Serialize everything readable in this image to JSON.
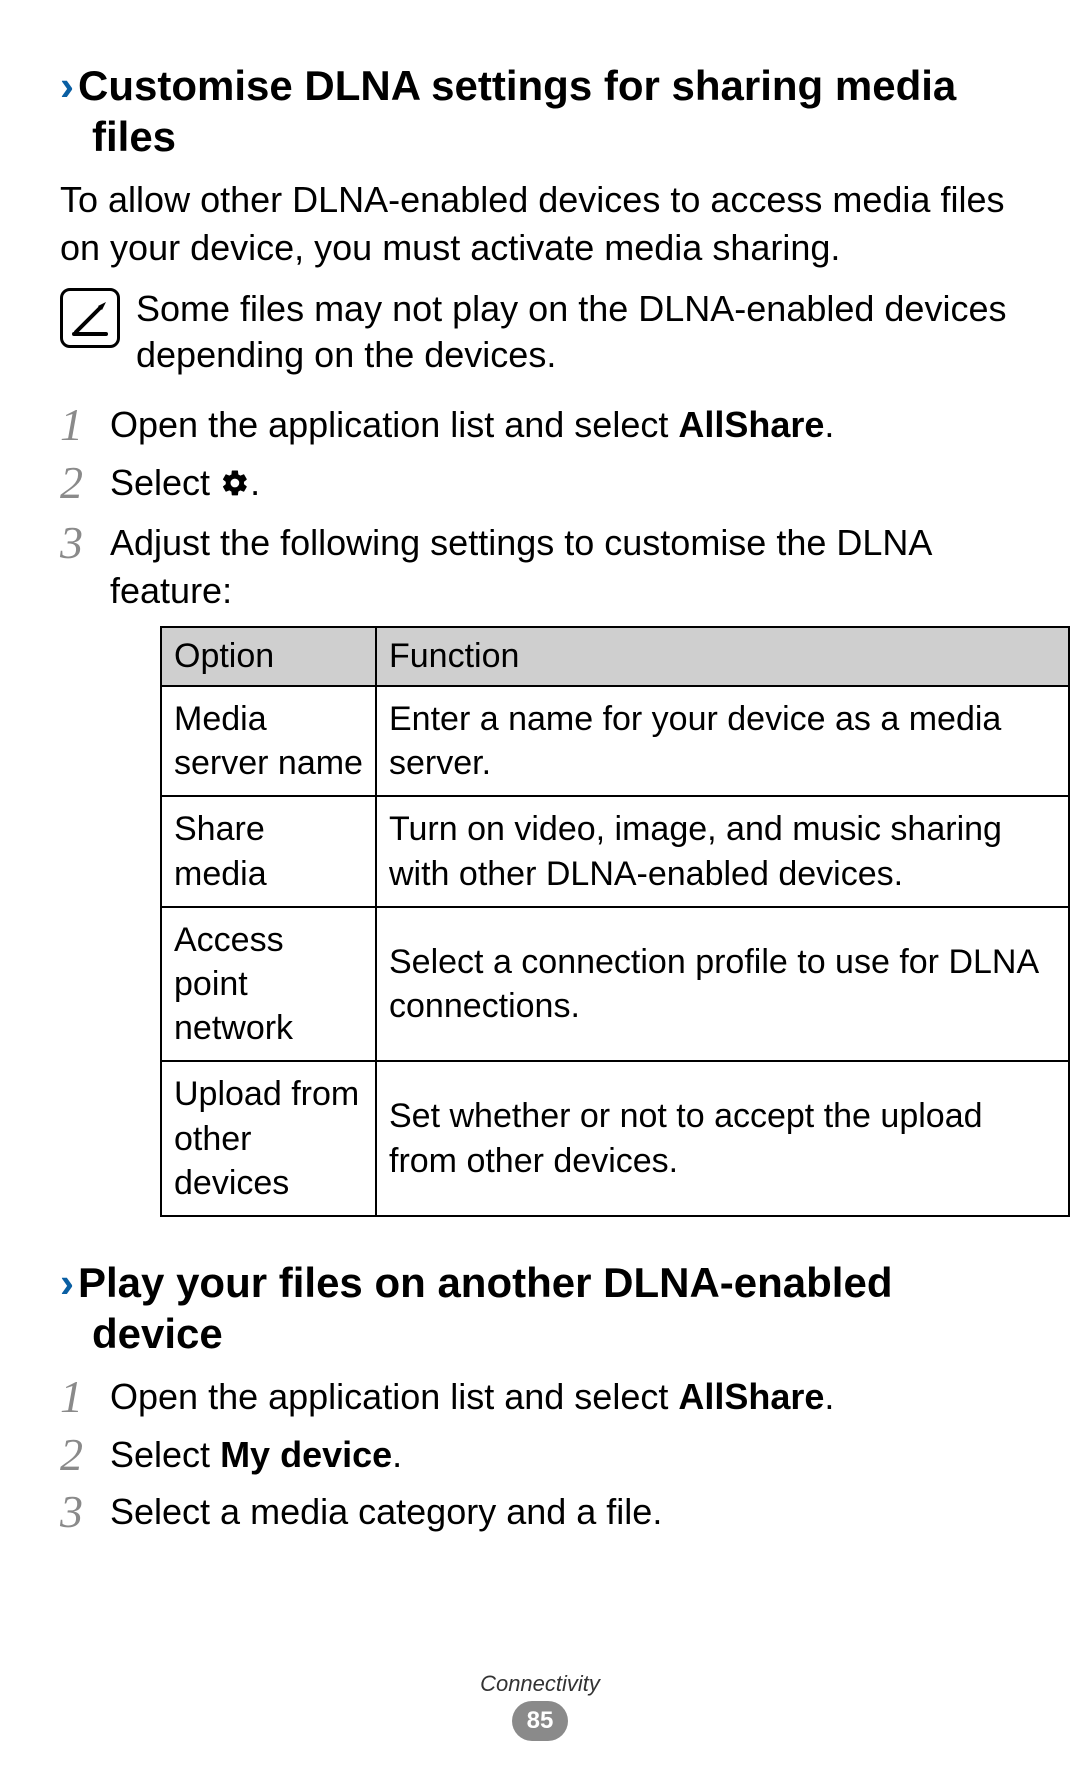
{
  "section1": {
    "heading_line1": "Customise DLNA settings for sharing media",
    "heading_line2": "files",
    "intro": "To allow other DLNA-enabled devices to access media files on your device, you must activate media sharing.",
    "note": "Some files may not play on the DLNA-enabled devices depending on the devices.",
    "steps": {
      "s1_pre": "Open the application list and select ",
      "s1_bold": "AllShare",
      "s1_post": ".",
      "s2_pre": "Select ",
      "s2_post": ".",
      "s3": "Adjust the following settings to customise the DLNA feature:"
    },
    "table": {
      "head_option": "Option",
      "head_function": "Function",
      "rows": [
        {
          "option": "Media server name",
          "function": "Enter a name for your device as a media server."
        },
        {
          "option": "Share media",
          "function": "Turn on video, image, and music sharing with other DLNA-enabled devices."
        },
        {
          "option": "Access point network",
          "function": "Select a connection profile to use for DLNA connections."
        },
        {
          "option": "Upload from other devices",
          "function": "Set whether or not to accept the upload from other devices."
        }
      ]
    }
  },
  "section2": {
    "heading_line1": "Play your files on another DLNA-enabled",
    "heading_line2": "device",
    "steps": {
      "s1_pre": "Open the application list and select ",
      "s1_bold": "AllShare",
      "s1_post": ".",
      "s2_pre": "Select ",
      "s2_bold": "My device",
      "s2_post": ".",
      "s3": "Select a media category and a file."
    }
  },
  "footer": {
    "category": "Connectivity",
    "page_number": "85"
  }
}
